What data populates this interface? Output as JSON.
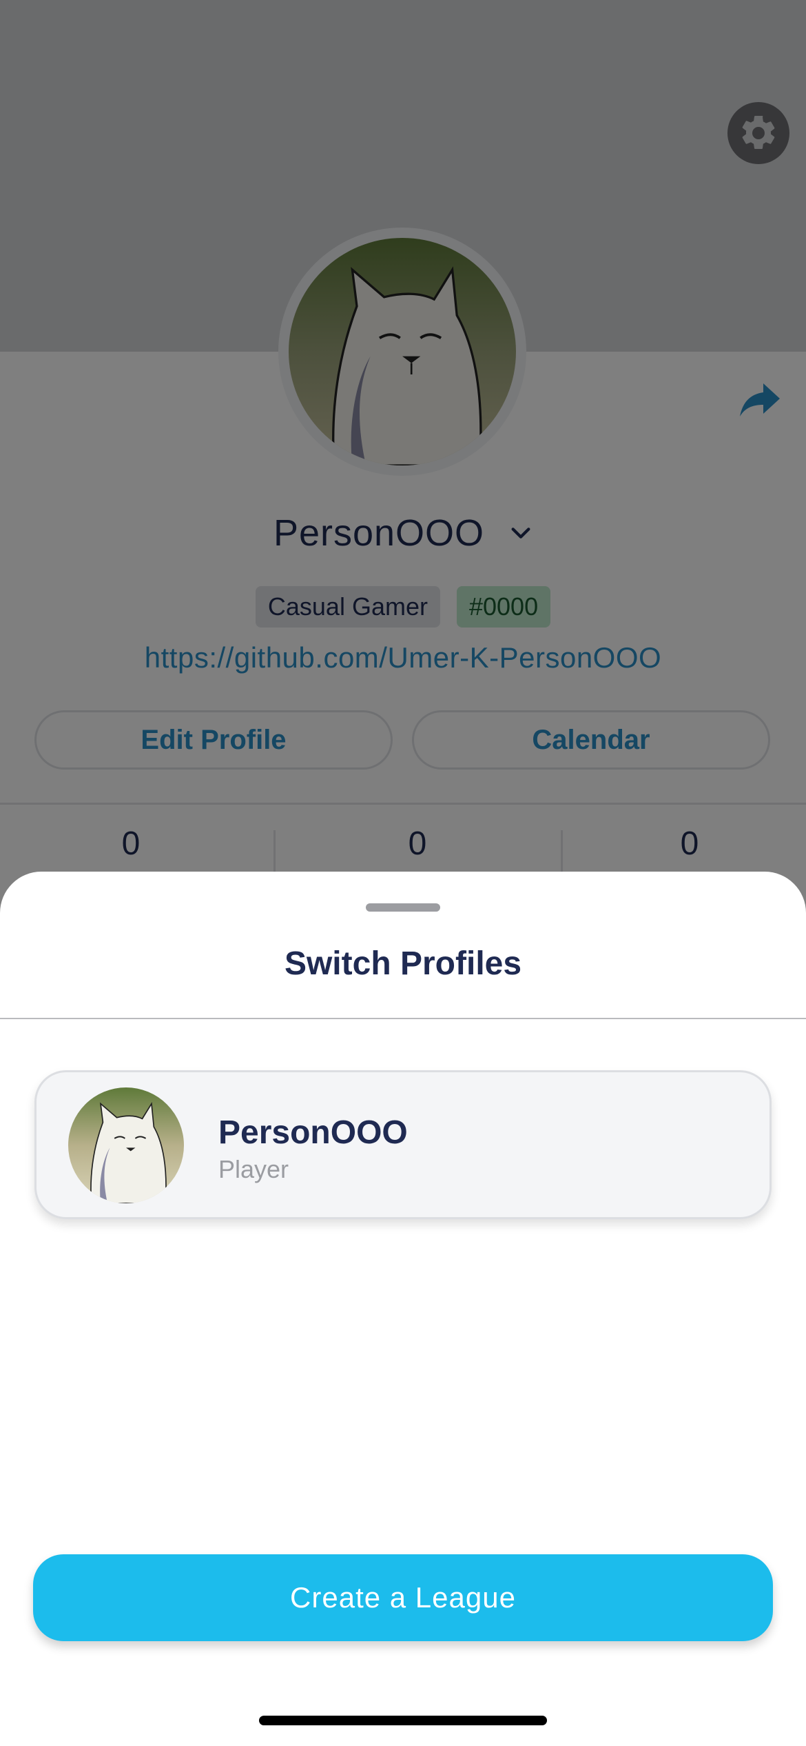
{
  "profile_page": {
    "username": "PersonOOO",
    "badges": {
      "tier": "Casual Gamer",
      "tag": "#0000"
    },
    "link": "https://github.com/Umer-K-PersonOOO",
    "buttons": {
      "edit_profile": "Edit Profile",
      "calendar": "Calendar"
    },
    "stats": [
      "0",
      "0",
      "0"
    ],
    "icons": {
      "settings": "gear-icon",
      "share": "share-arrow-icon",
      "dropdown": "chevron-down-icon"
    },
    "colors": {
      "link": "#2a8fc7",
      "text": "#1f2a52",
      "tag_bg": "#bfe8cc"
    }
  },
  "sheet": {
    "title": "Switch Profiles",
    "profiles": [
      {
        "name": "PersonOOO",
        "role": "Player"
      }
    ],
    "create_button": "Create a League",
    "colors": {
      "accent": "#1cbcec",
      "title": "#1f2a52"
    }
  }
}
